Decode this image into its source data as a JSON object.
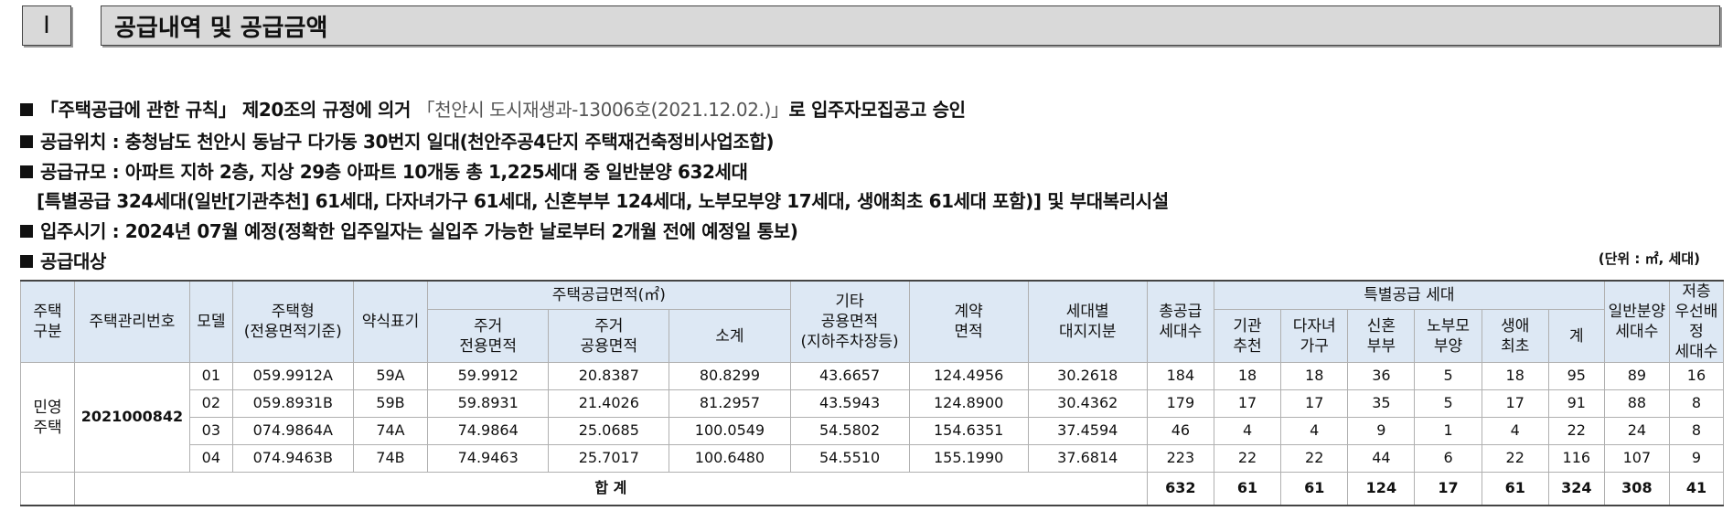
{
  "section": {
    "number": "I",
    "title": "공급내역 및 공급금액"
  },
  "notes": {
    "n1_prefix": "「주택공급에 관한 규칙」 제20조의 규정에 의거 ",
    "n1_highlight": "「천안시 도시재생과-13006호(2021.12.02.)」",
    "n1_suffix": "로 입주자모집공고 승인",
    "n2": "공급위치 : 충청남도 천안시 동남구 다가동 30번지 일대(천안주공4단지 주택재건축정비사업조합)",
    "n3": "공급규모 : 아파트 지하 2층, 지상 29층 아파트 10개동 총 1,225세대 중 일반분양 632세대",
    "n3b": "[특별공급 324세대(일반[기관추천] 61세대, 다자녀가구 61세대, 신혼부부 124세대, 노부모부양 17세대, 생애최초 61세대 포함)] 및 부대복리시설",
    "n4": "입주시기 : 2024년 07월 예정(정확한 입주일자는 실입주 가능한 날로부터 2개월 전에 예정일 통보)",
    "n5": "공급대상",
    "unit": "(단위 : ㎡, 세대)"
  },
  "table": {
    "headers": {
      "housing_type": "주택\n구분",
      "mgmt_no": "주택관리번호",
      "model": "모델",
      "type": "주택형\n(전용면적기준)",
      "short": "약식표기",
      "area_group": "주택공급면적(㎡)",
      "exclusive": "주거\n전용면적",
      "common": "주거\n공용면적",
      "subtotal": "소계",
      "other_common": "기타\n공용면적\n(지하주차장등)",
      "contract": "계약\n면적",
      "land": "세대별\n대지지분",
      "total_supply": "총공급\n세대수",
      "special_group": "특별공급 세대",
      "sp_inst": "기관\n추천",
      "sp_multi": "다자녀\n가구",
      "sp_newlywed": "신혼\n부부",
      "sp_parent": "노부모\n부양",
      "sp_first": "생애\n최초",
      "sp_sum": "계",
      "general": "일반분양\n세대수",
      "lower_floor": "저층\n우선배정\n세대수"
    },
    "group_label": "민영\n주택",
    "mgmt_number": "2021000842",
    "rows": [
      {
        "model": "01",
        "type": "059.9912A",
        "short": "59A",
        "excl": "59.9912",
        "comm": "20.8387",
        "sub": "80.8299",
        "other": "43.6657",
        "contract": "124.4956",
        "land": "30.2618",
        "total": "184",
        "inst": "18",
        "multi": "18",
        "newly": "36",
        "parent": "5",
        "first": "18",
        "sum": "95",
        "general": "89",
        "lower": "16"
      },
      {
        "model": "02",
        "type": "059.8931B",
        "short": "59B",
        "excl": "59.8931",
        "comm": "21.4026",
        "sub": "81.2957",
        "other": "43.5943",
        "contract": "124.8900",
        "land": "30.4362",
        "total": "179",
        "inst": "17",
        "multi": "17",
        "newly": "35",
        "parent": "5",
        "first": "17",
        "sum": "91",
        "general": "88",
        "lower": "8"
      },
      {
        "model": "03",
        "type": "074.9864A",
        "short": "74A",
        "excl": "74.9864",
        "comm": "25.0685",
        "sub": "100.0549",
        "other": "54.5802",
        "contract": "154.6351",
        "land": "37.4594",
        "total": "46",
        "inst": "4",
        "multi": "4",
        "newly": "9",
        "parent": "1",
        "first": "4",
        "sum": "22",
        "general": "24",
        "lower": "8"
      },
      {
        "model": "04",
        "type": "074.9463B",
        "short": "74B",
        "excl": "74.9463",
        "comm": "25.7017",
        "sub": "100.6480",
        "other": "54.5510",
        "contract": "155.1990",
        "land": "37.6814",
        "total": "223",
        "inst": "22",
        "multi": "22",
        "newly": "44",
        "parent": "6",
        "first": "22",
        "sum": "116",
        "general": "107",
        "lower": "9"
      }
    ],
    "totals": {
      "label": "합 계",
      "total": "632",
      "inst": "61",
      "multi": "61",
      "newly": "124",
      "parent": "17",
      "first": "61",
      "sum": "324",
      "general": "308",
      "lower": "41"
    }
  }
}
